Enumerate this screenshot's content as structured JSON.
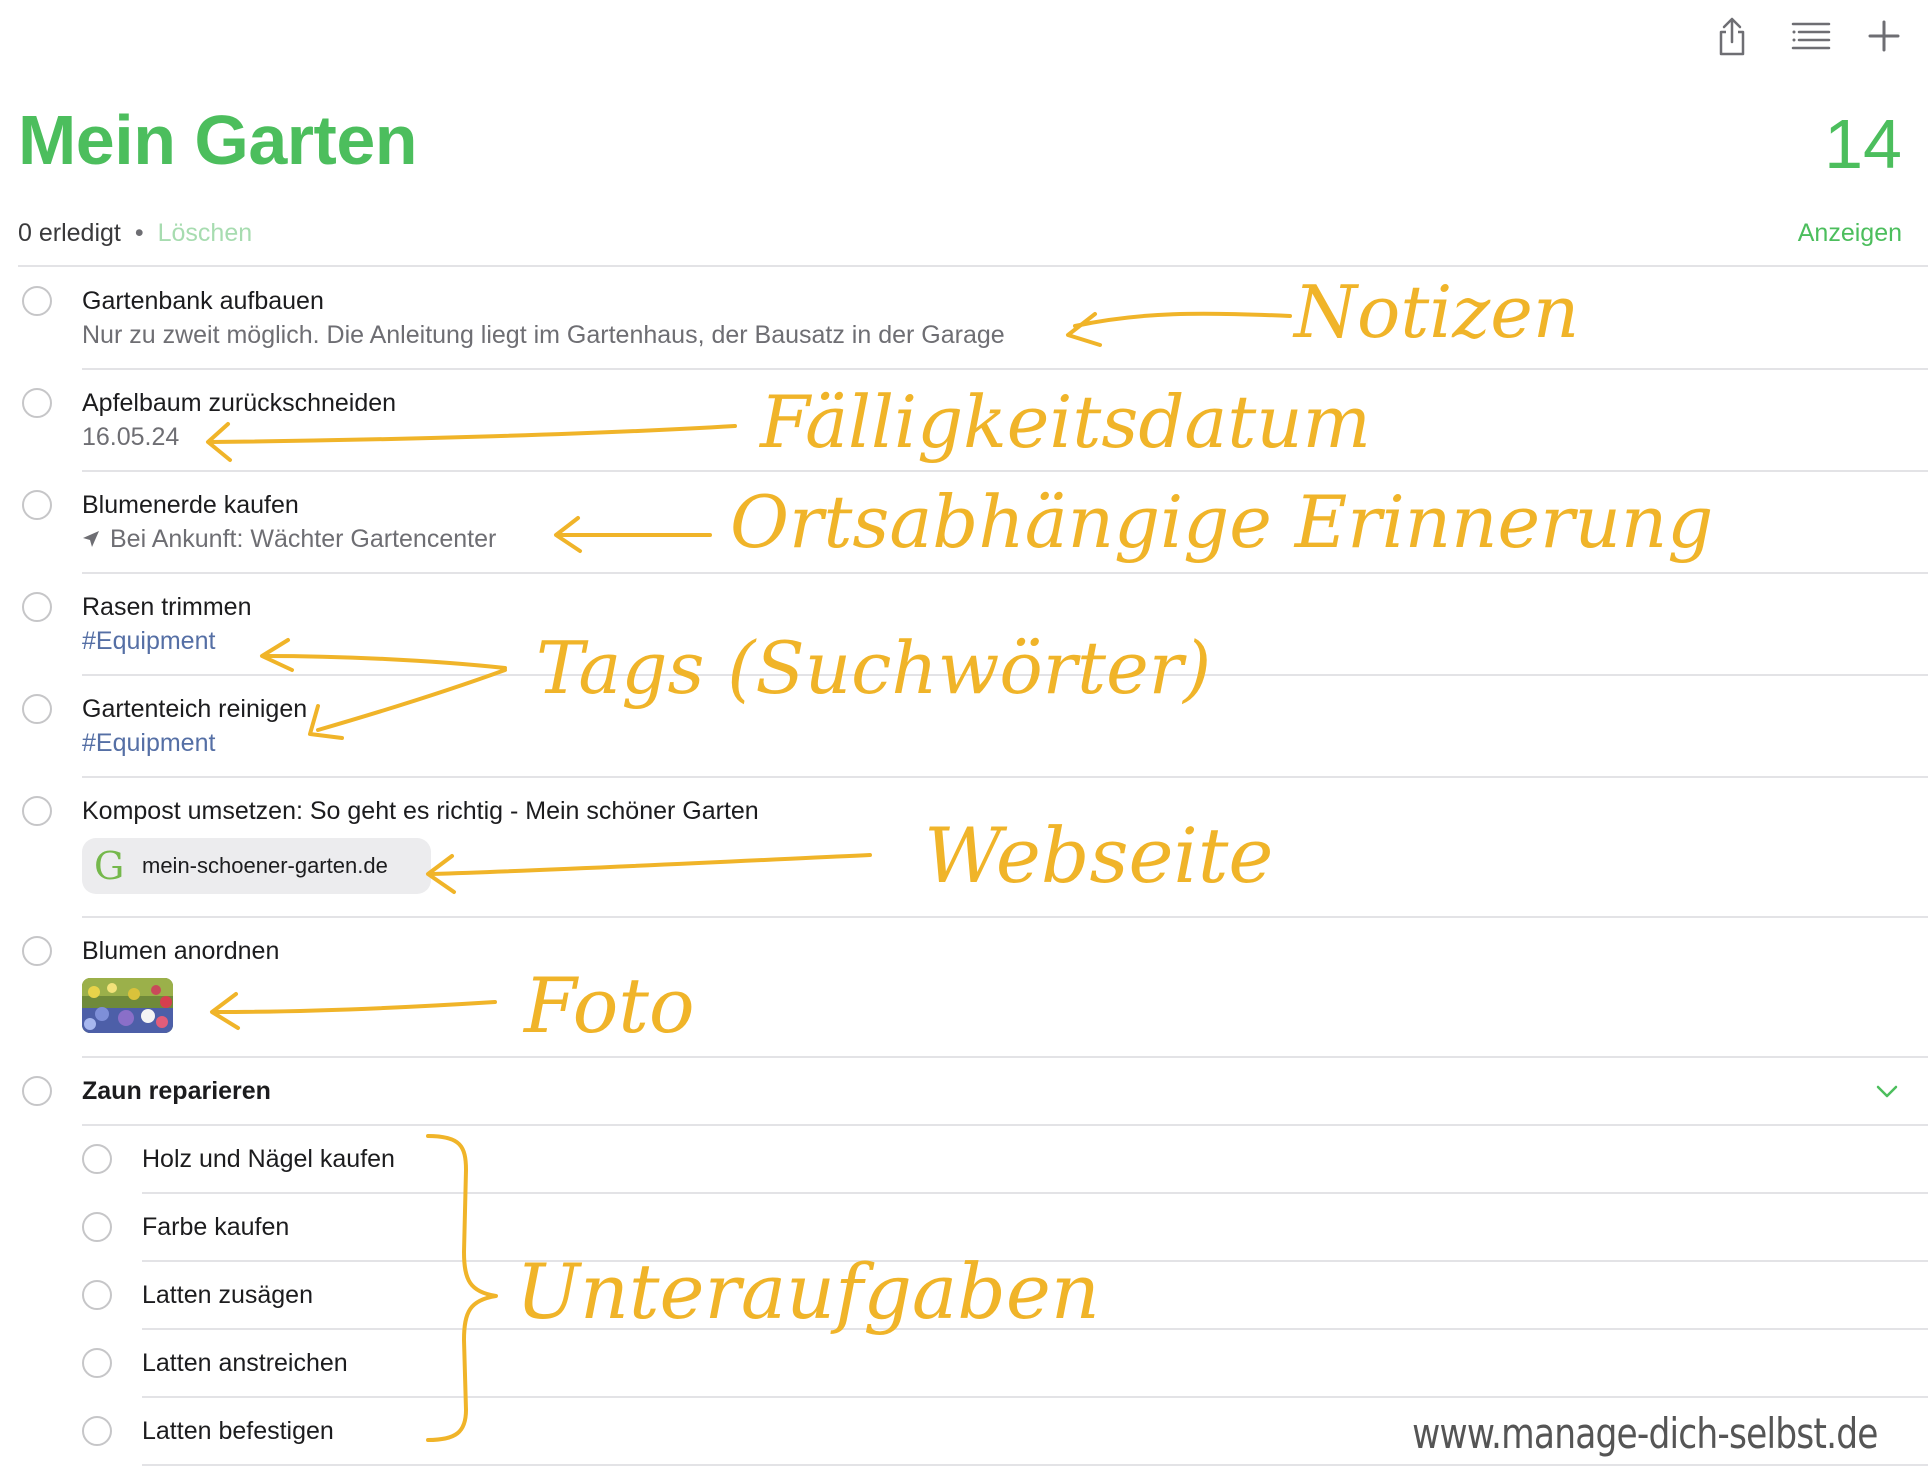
{
  "toolbar": {
    "share_icon": "share-icon",
    "list_icon": "list-options-icon",
    "add_icon": "plus-icon"
  },
  "header": {
    "title": "Mein Garten",
    "count": "14"
  },
  "meta": {
    "done": "0 erledigt",
    "dot": "•",
    "delete": "Löschen",
    "show": "Anzeigen"
  },
  "reminders": [
    {
      "title": "Gartenbank aufbauen",
      "note": "Nur zu zweit möglich. Die Anleitung liegt im Gartenhaus, der Bausatz in der Garage"
    },
    {
      "title": "Apfelbaum zurückschneiden",
      "date": "16.05.24"
    },
    {
      "title": "Blumenerde kaufen",
      "location": "Bei Ankunft: Wächter Gartencenter"
    },
    {
      "title": "Rasen trimmen",
      "tag": "#Equipment"
    },
    {
      "title": "Gartenteich reinigen",
      "tag": "#Equipment"
    },
    {
      "title": "Kompost umsetzen: So geht es richtig - Mein schöner Garten",
      "link_letter": "G",
      "link_domain": "mein-schoener-garten.de"
    },
    {
      "title": "Blumen anordnen"
    },
    {
      "title": "Zaun reparieren"
    }
  ],
  "subtasks": [
    "Holz und Nägel kaufen",
    "Farbe kaufen",
    "Latten zusägen",
    "Latten anstreichen",
    "Latten befestigen"
  ],
  "annotations": {
    "notes": "Notizen",
    "due": "Fälligkeitsdatum",
    "location": "Ortsabhängige Erinnerung",
    "tags": "Tags (Suchwörter)",
    "website": "Webseite",
    "photo": "Foto",
    "subtasks": "Unteraufgaben"
  },
  "watermark": "www.manage-dich-selbst.de",
  "colors": {
    "accent": "#4cbe5d",
    "tag": "#556fa5",
    "annotation": "#f0b429"
  }
}
